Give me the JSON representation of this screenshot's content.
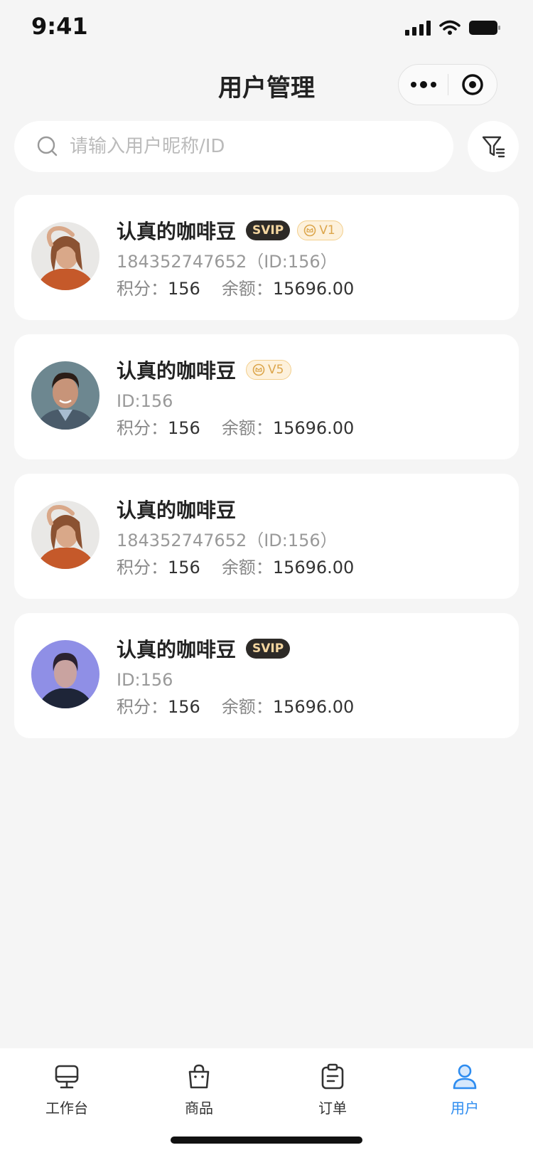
{
  "status_bar": {
    "time": "9:41"
  },
  "nav": {
    "title": "用户管理"
  },
  "search": {
    "placeholder": "请输入用户昵称/ID"
  },
  "users": [
    {
      "name": "认真的咖啡豆",
      "svip": "SVIP",
      "level": "V1",
      "sub": "184352747652（ID:156）",
      "points_label": "积分：",
      "points": "156",
      "balance_label": "余额：",
      "balance": "15696.00",
      "avatar": "woman-orange-top"
    },
    {
      "name": "认真的咖啡豆",
      "svip": null,
      "level": "V5",
      "sub": "ID:156",
      "points_label": "积分：",
      "points": "156",
      "balance_label": "余额：",
      "balance": "15696.00",
      "avatar": "man-suit"
    },
    {
      "name": "认真的咖啡豆",
      "svip": null,
      "level": null,
      "sub": "184352747652（ID:156）",
      "points_label": "积分：",
      "points": "156",
      "balance_label": "余额：",
      "balance": "15696.00",
      "avatar": "woman-orange-top"
    },
    {
      "name": "认真的咖啡豆",
      "svip": "SVIP",
      "level": null,
      "sub": "ID:156",
      "points_label": "积分：",
      "points": "156",
      "balance_label": "余额：",
      "balance": "15696.00",
      "avatar": "woman-blue-light"
    }
  ],
  "tabbar": {
    "items": [
      {
        "label": "工作台",
        "icon": "workbench-icon"
      },
      {
        "label": "商品",
        "icon": "shopping-bag-icon"
      },
      {
        "label": "订单",
        "icon": "order-clipboard-icon"
      },
      {
        "label": "用户",
        "icon": "user-icon",
        "active": true
      }
    ]
  },
  "colors": {
    "accent": "#2d8cf0",
    "svip_bg": "#2d2a27",
    "svip_text": "#f4d6a0",
    "level_text": "#dca64c"
  }
}
